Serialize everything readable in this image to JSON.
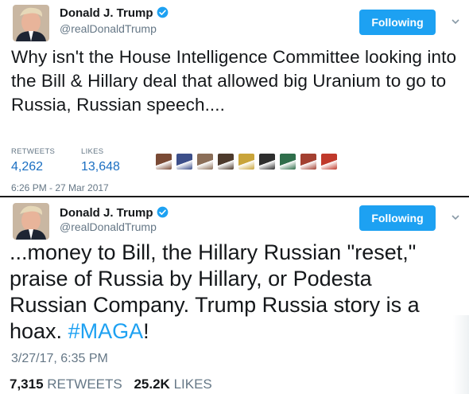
{
  "tweet1": {
    "name": "Donald J. Trump",
    "handle": "@realDonaldTrump",
    "follow_label": "Following",
    "text": "Why isn't the House Intelligence Committee looking into the Bill & Hillary deal that allowed big Uranium to go to Russia, Russian speech....",
    "retweets_label": "RETWEETS",
    "retweets_value": "4,262",
    "likes_label": "LIKES",
    "likes_value": "13,648",
    "timestamp": "6:26 PM - 27 Mar 2017",
    "liker_avatars": [
      "#7a4a35",
      "#3d4f8a",
      "#8b6e58",
      "#4d3a2c",
      "#c9a43a",
      "#2e2e2e",
      "#2f6e4b",
      "#a34031",
      "#c0392b"
    ]
  },
  "tweet2": {
    "name": "Donald J. Trump",
    "handle": "@realDonaldTrump",
    "follow_label": "Following",
    "text_main": "...money to Bill, the Hillary Russian \"reset,\" praise of Russia by Hillary, or Podesta Russian Company. Trump Russia story is a hoax. ",
    "hashtag": "#MAGA",
    "text_end": "!",
    "timestamp": "3/27/17, 6:35 PM",
    "retweets_value": "7,315",
    "retweets_label": "RETWEETS",
    "likes_value": "25.2K",
    "likes_label": "LIKES"
  },
  "colors": {
    "accent": "#1da1f2",
    "secondary_text": "#657786",
    "primary_text": "#14171a",
    "stat_value": "#1b6fc2"
  },
  "icons": [
    "verified-badge-icon",
    "chevron-down-icon"
  ]
}
